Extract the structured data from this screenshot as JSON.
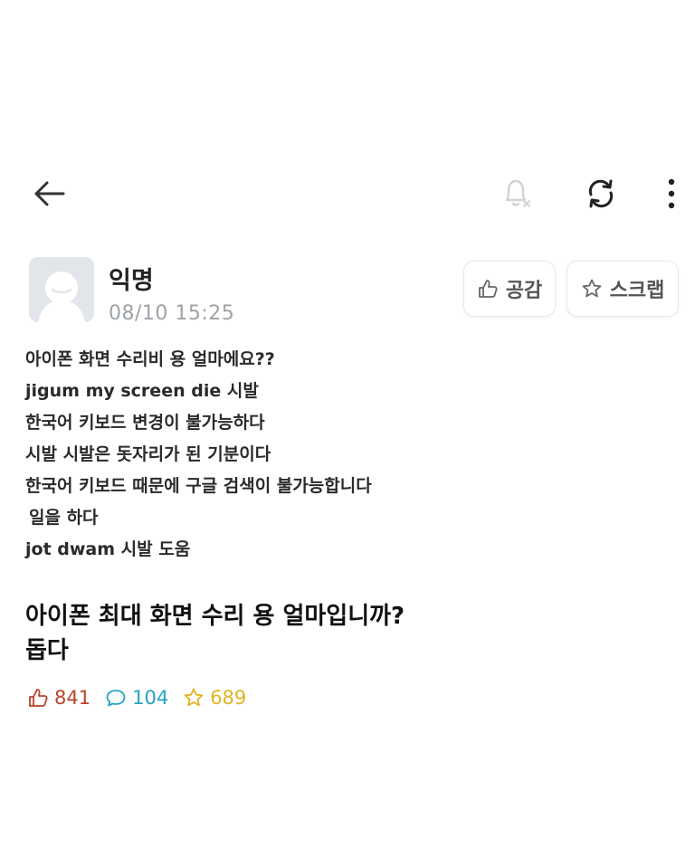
{
  "toolbar": {
    "back_icon": "arrow-left-icon",
    "notification_icon": "bell-off-icon",
    "refresh_icon": "refresh-icon",
    "more_icon": "vertical-dots-icon"
  },
  "post": {
    "author": "익명",
    "time": "08/10 15:25",
    "avatar_icon": "default-avatar-icon",
    "like_button": "공감",
    "scrap_button": "스크랩",
    "body_lines": [
      "아이폰 화면 수리비 용 얼마에요??",
      "jigum my screen die 시발",
      "한국어 키보드 변경이 불가능하다",
      "시발 시발은 돗자리가 된 기분이다",
      "한국어 키보드 때문에 구글 검색이 불가능합니다",
      "일을 하다",
      "jot dwam 시발 도움"
    ],
    "headline_lines": [
      "아이폰 최대 화면 수리 용 얼마입니까?",
      "돕다"
    ]
  },
  "stats": {
    "likes": "841",
    "comments": "104",
    "scraps": "689",
    "likes_color": "#b8442a",
    "comments_color": "#27a2c0",
    "scraps_color": "#e2b320"
  }
}
